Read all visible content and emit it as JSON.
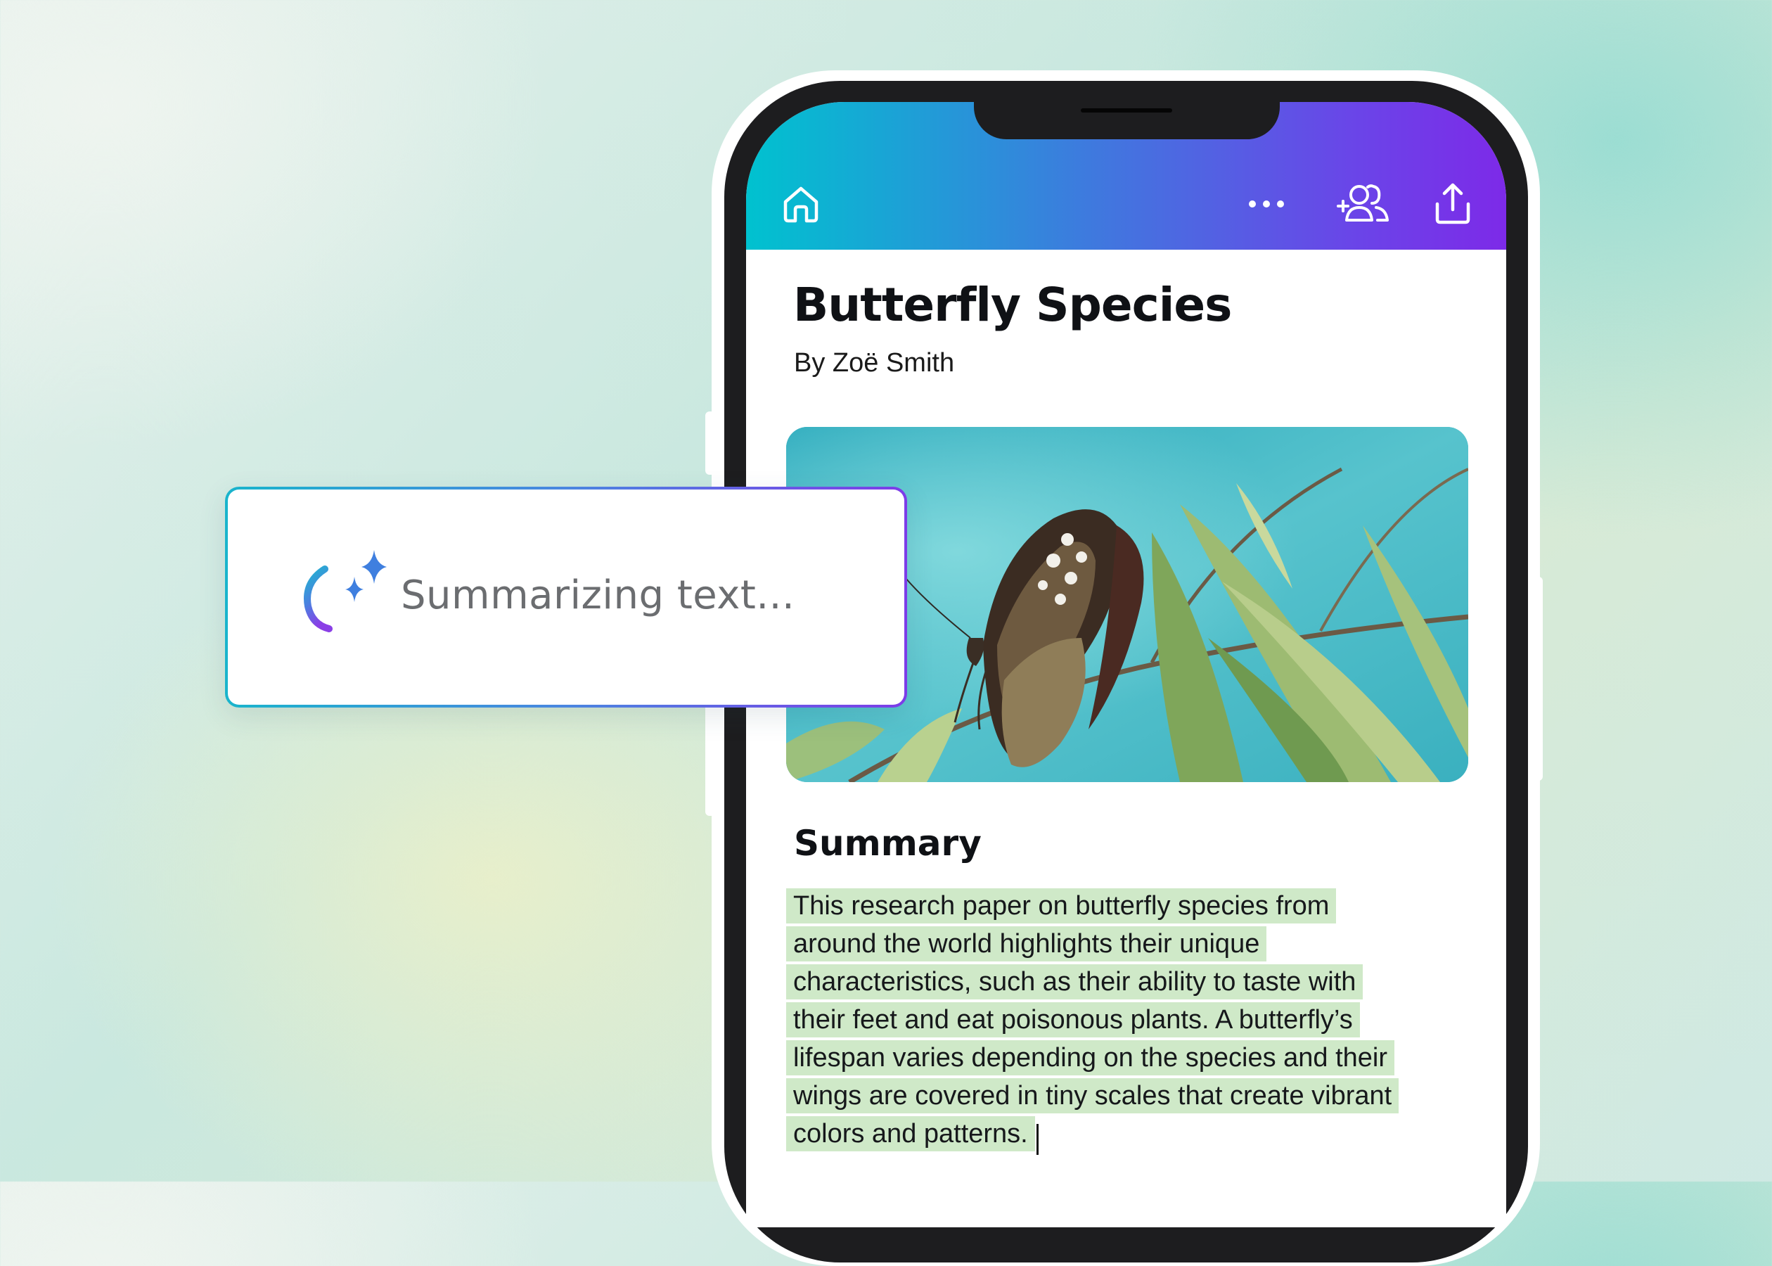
{
  "header": {
    "home_icon": "home-icon",
    "more_icon": "more-dots-icon",
    "share_people_icon": "add-people-icon",
    "export_icon": "share-upload-icon",
    "gradient": [
      "#00c2cf",
      "#3e7ade",
      "#6a45e8",
      "#7d2ae8"
    ]
  },
  "document": {
    "title": "Butterfly Species",
    "author": "By Zoë Smith",
    "summary_heading": "Summary",
    "summary_lines": [
      "This research paper on butterfly species from",
      "around the world highlights their unique",
      "characteristics, such as their ability to taste with",
      "their feet and eat poisonous plants. A butterfly’s",
      "lifespan varies depending on the species and their",
      "wings are covered in tiny scales that create vibrant",
      "colors and patterns."
    ],
    "highlight_color": "#cfe9c8"
  },
  "ai_loader": {
    "status_text": "Summarizing text...",
    "icon": "magic-sparkle-icon",
    "border_gradient": [
      "#19b4cc",
      "#4a86e0",
      "#7d3ce8"
    ]
  }
}
